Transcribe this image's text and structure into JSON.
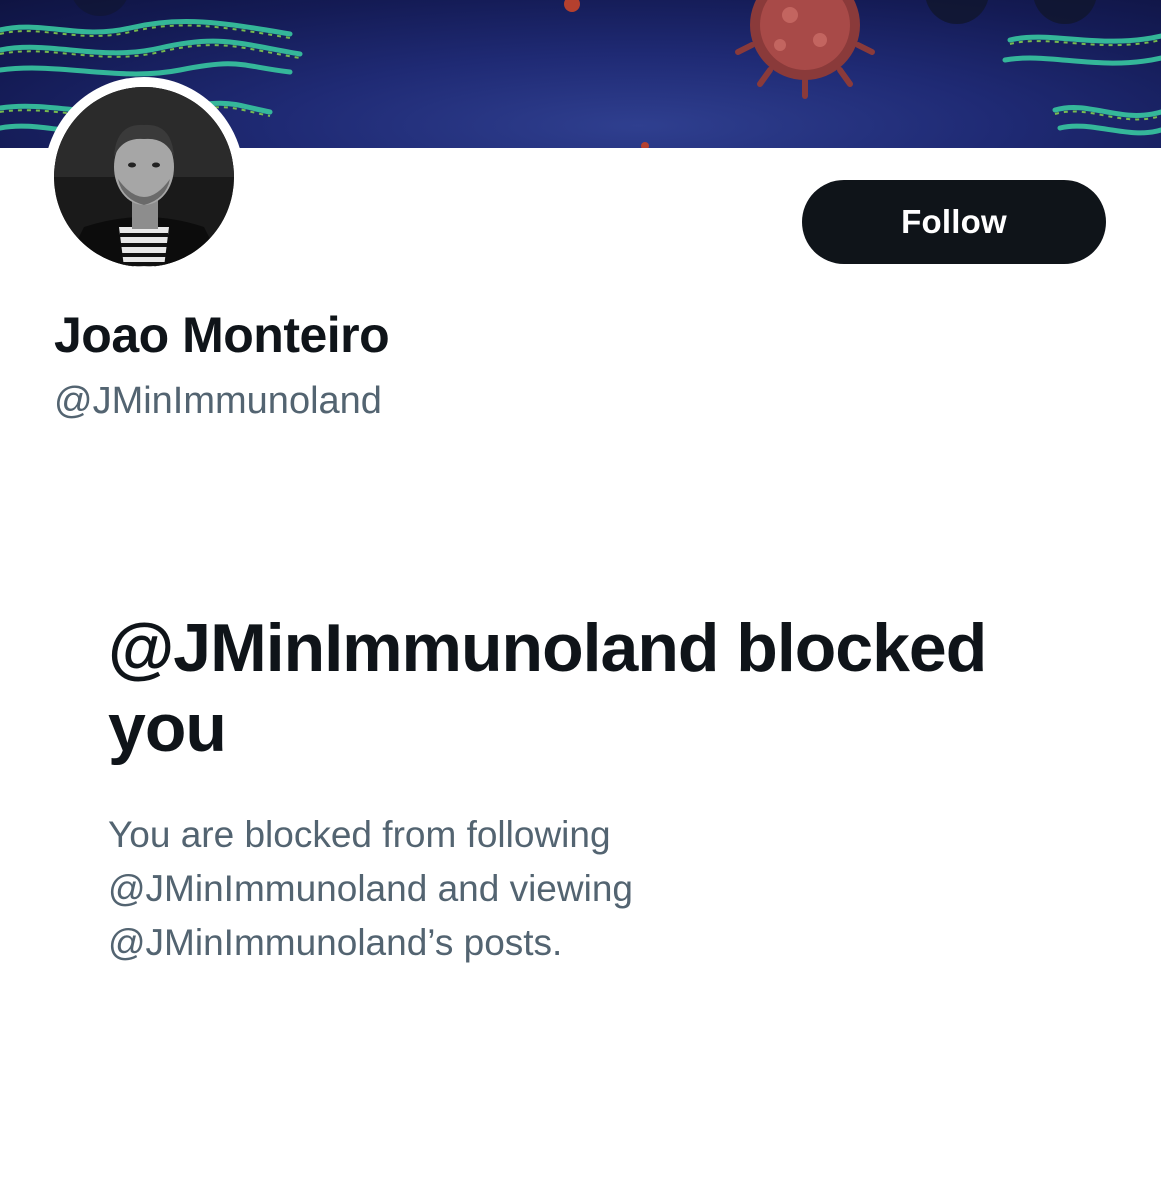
{
  "profile": {
    "display_name": "Joao Monteiro",
    "handle": "@JMinImmunoland",
    "follow_label": "Follow"
  },
  "blocked_notice": {
    "title": "@JMinImmunoland blocked you",
    "description": "You are blocked from following @JMinImmunoland and viewing @JMinImmunoland’s posts."
  },
  "colors": {
    "primary_text": "#0f1419",
    "secondary_text": "#536471",
    "button_bg": "#0f1419",
    "banner_bg": "#1f2a74"
  }
}
